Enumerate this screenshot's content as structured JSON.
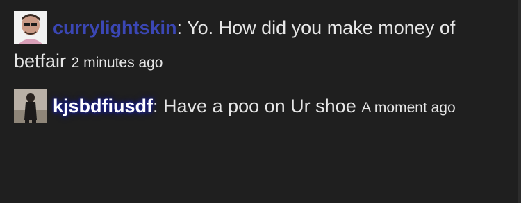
{
  "comments": [
    {
      "avatar_icon": "user-avatar-icon",
      "username": "currylightskin",
      "username_color": "#3b47b5",
      "separator": ": ",
      "message": "Yo. How did you make money of betfair",
      "timestamp": "2 minutes ago"
    },
    {
      "avatar_icon": "user-avatar-icon",
      "username": "kjsbdfiusdf",
      "username_color": "#ffffff",
      "separator": ": ",
      "message": "Have a poo on Ur shoe",
      "timestamp": "A moment ago"
    }
  ],
  "colors": {
    "background": "#1f1f1f",
    "text": "#e6e6e6",
    "glow": "#1a1f8a"
  }
}
